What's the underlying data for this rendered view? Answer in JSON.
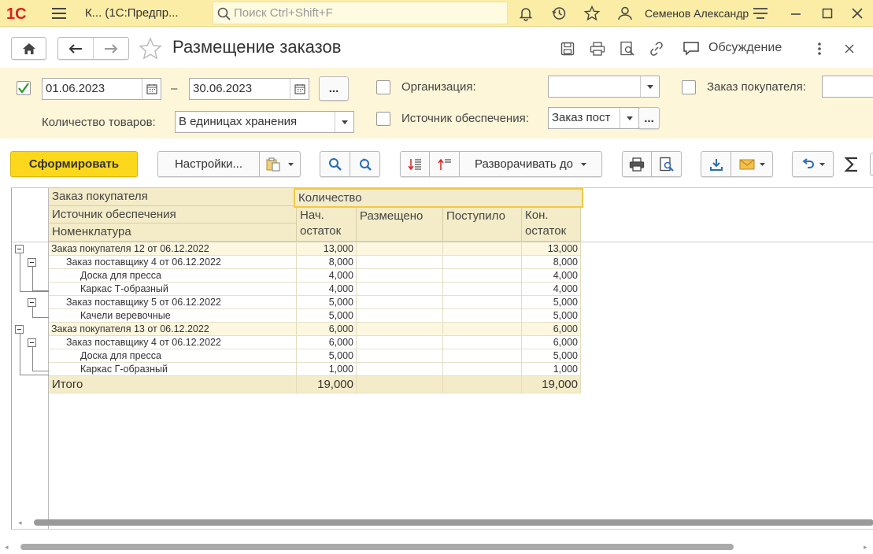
{
  "app": {
    "title": "К...  (1С:Предпр...",
    "search_placeholder": "Поиск Ctrl+Shift+F",
    "user": "Семенов Александр"
  },
  "header": {
    "page_title": "Размещение заказов",
    "discussion_label": "Обсуждение"
  },
  "filter": {
    "date_from": "01.06.2023",
    "dash": "–",
    "date_to": "30.06.2023",
    "more_label": "...",
    "organization_label": "Организация:",
    "organization_value": "",
    "customer_order_label": "Заказ покупателя:",
    "customer_order_value": "",
    "quantity_label": "Количество товаров:",
    "quantity_value": "В единицах хранения",
    "source_label": "Источник обеспечения:",
    "source_value": "Заказ пост",
    "period_checked": true
  },
  "toolbar": {
    "generate_label": "Сформировать",
    "settings_label": "Настройки...",
    "expand_label": "Разворачивать до"
  },
  "report": {
    "col_group_label": "Заказ покупателя",
    "col_source_label": "Источник обеспечения",
    "col_item_label": "Номенклатура",
    "quantity_header": "Количество",
    "col_start": "Нач. остаток",
    "col_placed": "Размещено",
    "col_received": "Поступило",
    "col_end": "Кон. остаток",
    "rows": [
      {
        "label": "Заказ покупателя 12 от 06.12.2022",
        "start": "13,000",
        "placed": "",
        "received": "",
        "end": "13,000",
        "level": 0
      },
      {
        "label": "Заказ поставщику 4 от 06.12.2022",
        "start": "8,000",
        "placed": "",
        "received": "",
        "end": "8,000",
        "level": 1
      },
      {
        "label": "Доска для пресса",
        "start": "4,000",
        "placed": "",
        "received": "",
        "end": "4,000",
        "level": 2
      },
      {
        "label": "Каркас Т-образный",
        "start": "4,000",
        "placed": "",
        "received": "",
        "end": "4,000",
        "level": 2
      },
      {
        "label": "Заказ поставщику 5 от 06.12.2022",
        "start": "5,000",
        "placed": "",
        "received": "",
        "end": "5,000",
        "level": 1
      },
      {
        "label": "Качели веревочные",
        "start": "5,000",
        "placed": "",
        "received": "",
        "end": "5,000",
        "level": 2
      },
      {
        "label": "Заказ покупателя 13 от 06.12.2022",
        "start": "6,000",
        "placed": "",
        "received": "",
        "end": "6,000",
        "level": 0
      },
      {
        "label": "Заказ поставщику 4 от 06.12.2022",
        "start": "6,000",
        "placed": "",
        "received": "",
        "end": "6,000",
        "level": 1
      },
      {
        "label": "Доска для пресса",
        "start": "5,000",
        "placed": "",
        "received": "",
        "end": "5,000",
        "level": 2
      },
      {
        "label": "Каркас Г-образный",
        "start": "1,000",
        "placed": "",
        "received": "",
        "end": "1,000",
        "level": 2
      }
    ],
    "total": {
      "label": "Итого",
      "start": "19,000",
      "placed": "",
      "received": "",
      "end": "19,000"
    }
  },
  "colors": {
    "topbar": "#fbeda6",
    "accent_yellow": "#fbd81b",
    "filter_bg": "#fdf6d8",
    "header_cell": "#f4ecc8",
    "brand_red": "#d7241f",
    "icon_blue": "#2a6cb3"
  }
}
